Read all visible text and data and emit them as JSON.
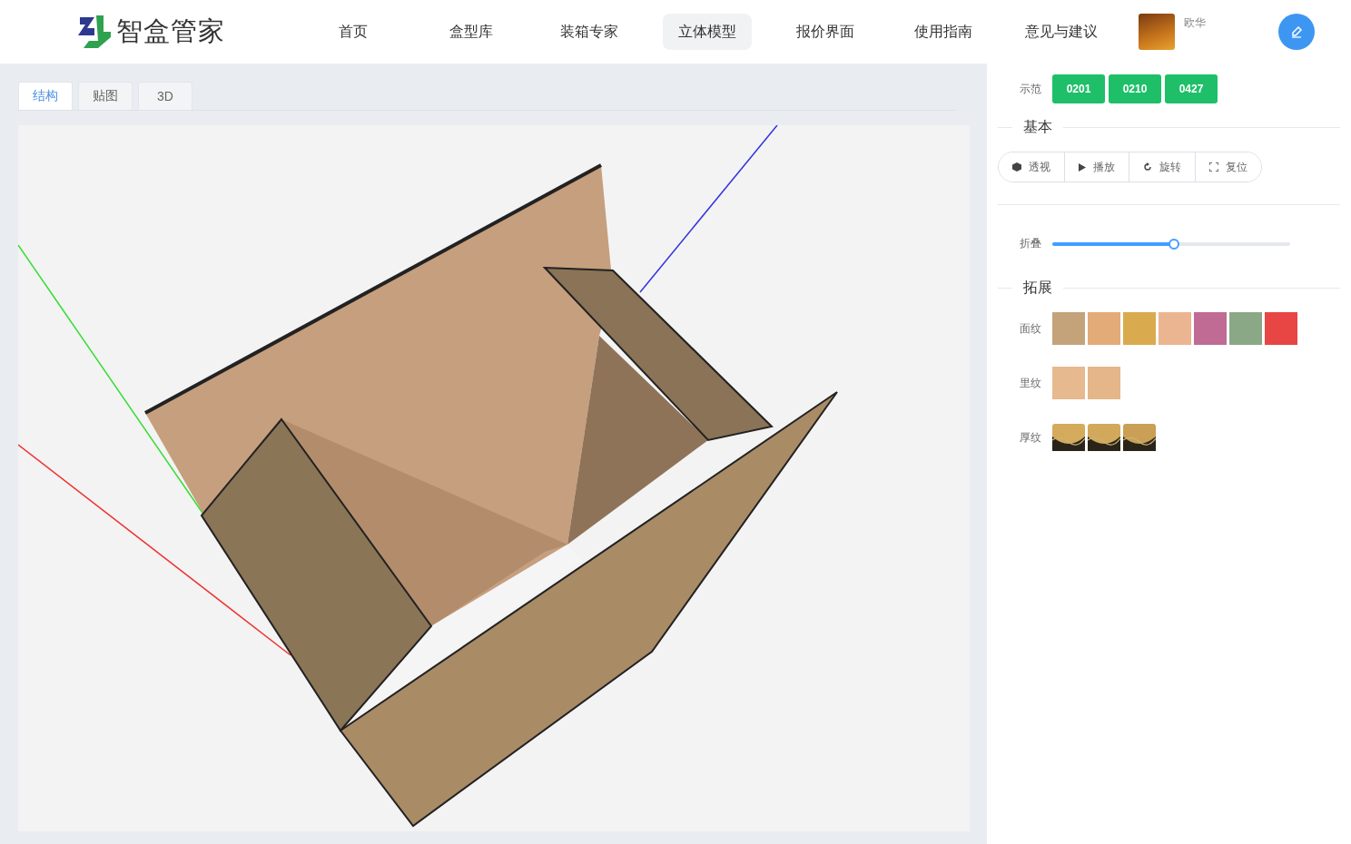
{
  "brand": {
    "name": "智盒管家"
  },
  "nav": [
    {
      "label": "首页",
      "selected": false
    },
    {
      "label": "盒型库",
      "selected": false
    },
    {
      "label": "装箱专家",
      "selected": false
    },
    {
      "label": "立体模型",
      "selected": true
    },
    {
      "label": "报价界面",
      "selected": false
    },
    {
      "label": "使用指南",
      "selected": false
    },
    {
      "label": "意见与建议",
      "selected": false
    }
  ],
  "user": {
    "name": "欧华"
  },
  "view_tabs": [
    {
      "label": "结构",
      "selected": true
    },
    {
      "label": "贴图",
      "selected": false
    },
    {
      "label": "3D",
      "selected": false
    }
  ],
  "panel": {
    "demo_label": "示范",
    "demos": [
      "0201",
      "0210",
      "0427"
    ],
    "basic_title": "基本",
    "controls": [
      {
        "kind": "cube",
        "label": "透视"
      },
      {
        "kind": "play",
        "label": "播放"
      },
      {
        "kind": "rotate",
        "label": "旋转"
      },
      {
        "kind": "reset",
        "label": "复位"
      }
    ],
    "fold": {
      "label": "折叠",
      "level": 0.51
    },
    "extend_title": "拓展",
    "face": {
      "label": "面纹",
      "swatches": [
        {
          "color": "#c4a37b"
        },
        {
          "color": "#e2ab78"
        },
        {
          "color": "#d9ab4e"
        },
        {
          "color": "#ebb591"
        },
        {
          "color": "#bf6b94"
        },
        {
          "color": "#8aa886"
        },
        {
          "color": "#e84545"
        }
      ]
    },
    "inner": {
      "label": "里纹",
      "swatches": [
        {
          "color": "#e6b98f"
        },
        {
          "color": "#e4b68a"
        }
      ]
    },
    "thick": {
      "label": "厚纹",
      "swatches": [
        {
          "color": "#d4aa5c"
        },
        {
          "color": "#d2a85a"
        },
        {
          "color": "#c9a055"
        }
      ]
    }
  }
}
